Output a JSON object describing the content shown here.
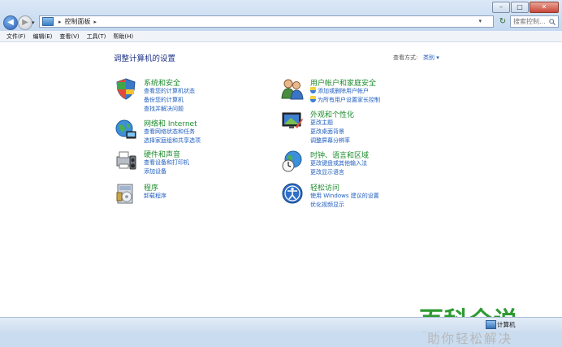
{
  "window": {
    "controls": {
      "minimize": "–",
      "maximize": "□",
      "close": "✕"
    }
  },
  "nav": {
    "back_glyph": "◀",
    "forward_glyph": "▶",
    "recent_glyph": "▾",
    "refresh_glyph": "↻"
  },
  "address": {
    "root_glyph": "▸",
    "location": "控制面板",
    "trail_glyph": "▸",
    "dropdown_glyph": "▾"
  },
  "search": {
    "placeholder": "搜索控制...",
    "icon": "search-icon"
  },
  "menu": [
    "文件(F)",
    "编辑(E)",
    "查看(V)",
    "工具(T)",
    "帮助(H)"
  ],
  "page": {
    "heading": "调整计算机的设置",
    "view_by_label": "查看方式:",
    "view_by_value": "类别 ▾"
  },
  "categories": [
    {
      "title": "系统和安全",
      "links": [
        "查看您的计算机状态",
        "备份您的计算机",
        "查找并解决问题"
      ],
      "icon": "system-security-icon"
    },
    {
      "title": "网络和 Internet",
      "links": [
        "查看网络状态和任务",
        "选择家庭组和共享选项"
      ],
      "icon": "network-icon"
    },
    {
      "title": "硬件和声音",
      "links": [
        "查看设备和打印机",
        "添加设备"
      ],
      "icon": "hardware-sound-icon"
    },
    {
      "title": "程序",
      "links": [
        "卸载程序"
      ],
      "icon": "programs-icon"
    },
    {
      "title": "用户帐户和家庭安全",
      "links": [
        "添加或删除用户帐户",
        "为所有用户设置家长控制"
      ],
      "icon": "user-accounts-icon"
    },
    {
      "title": "外观和个性化",
      "links": [
        "更改主题",
        "更改桌面背景",
        "调整屏幕分辨率"
      ],
      "icon": "appearance-icon"
    },
    {
      "title": "时钟、语言和区域",
      "links": [
        "更改键盘或其他输入法",
        "更改显示语言"
      ],
      "icon": "clock-region-icon"
    },
    {
      "title": "轻松访问",
      "links": [
        "使用 Windows 建议的设置",
        "优化视频显示"
      ],
      "icon": "ease-of-access-icon"
    }
  ],
  "watermark": {
    "line1": "百科全说",
    "line2": "助你轻松解决"
  },
  "status": {
    "label": "计算机"
  },
  "colors": {
    "category_title": "#1e8c2e",
    "link": "#1f5ebf",
    "heading": "#1e3287",
    "watermark": "#2f9a32"
  }
}
